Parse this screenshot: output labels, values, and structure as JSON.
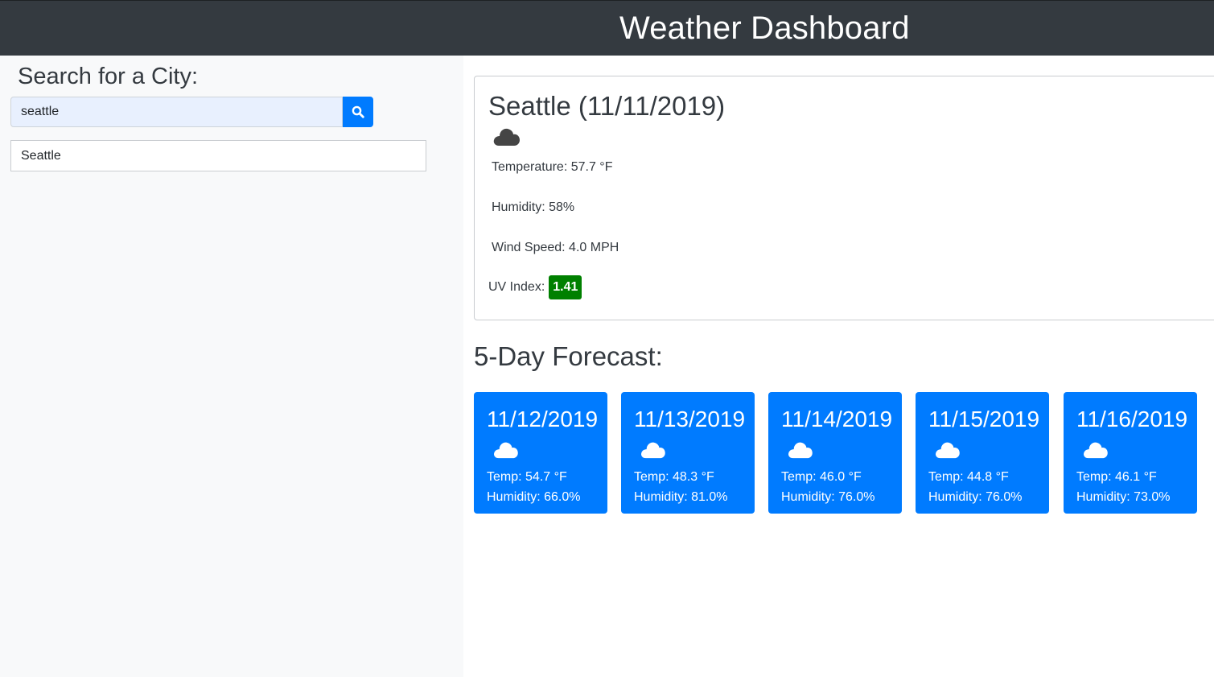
{
  "header": {
    "title": "Weather Dashboard"
  },
  "sidebar": {
    "heading": "Search for a City:",
    "search": {
      "value": "seattle",
      "button_icon": "search-icon"
    },
    "history": [
      {
        "label": "Seattle"
      }
    ]
  },
  "current": {
    "title": "Seattle (11/11/2019)",
    "icon": "cloud-icon",
    "temperature": "Temperature: 57.7 °F",
    "humidity": "Humidity: 58%",
    "wind": "Wind Speed: 4.0 MPH",
    "uv_label": "UV Index:",
    "uv_value": "1.41",
    "uv_color": "#008000"
  },
  "forecast": {
    "heading": "5-Day Forecast:",
    "days": [
      {
        "date": "11/12/2019",
        "icon": "cloud-icon",
        "temp": "Temp: 54.7 °F",
        "humidity": "Humidity: 66.0%"
      },
      {
        "date": "11/13/2019",
        "icon": "cloud-icon",
        "temp": "Temp: 48.3 °F",
        "humidity": "Humidity: 81.0%"
      },
      {
        "date": "11/14/2019",
        "icon": "cloud-icon",
        "temp": "Temp: 46.0 °F",
        "humidity": "Humidity: 76.0%"
      },
      {
        "date": "11/15/2019",
        "icon": "cloud-icon",
        "temp": "Temp: 44.8 °F",
        "humidity": "Humidity: 76.0%"
      },
      {
        "date": "11/16/2019",
        "icon": "cloud-icon",
        "temp": "Temp: 46.1 °F",
        "humidity": "Humidity: 73.0%"
      }
    ]
  },
  "colors": {
    "navbar": "#343a40",
    "primary": "#007bff",
    "sidebar_bg": "#f8f9fa"
  }
}
